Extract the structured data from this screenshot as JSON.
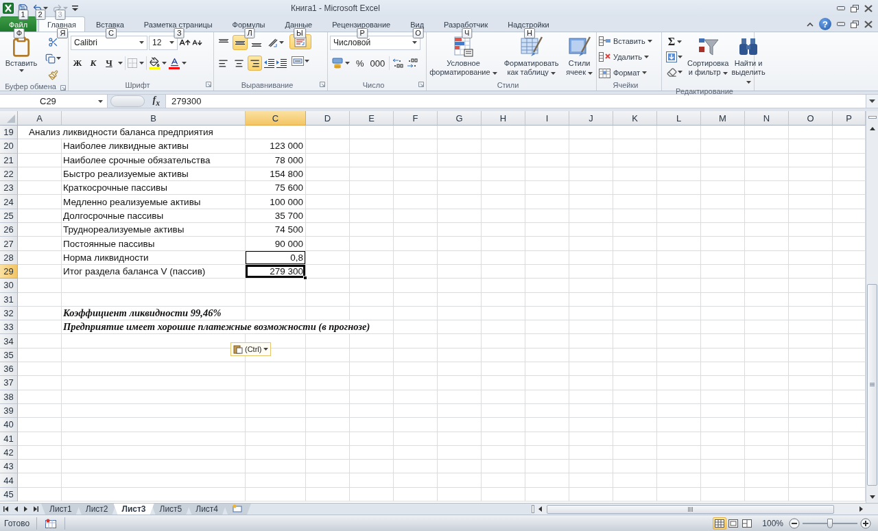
{
  "window": {
    "title": "Книга1  -  Microsoft Excel",
    "help": "?"
  },
  "quick_access": [
    {
      "kind": "save",
      "keytip": "1",
      "disabled": false
    },
    {
      "kind": "undo",
      "keytip": "2",
      "disabled": false
    },
    {
      "kind": "redo",
      "keytip": "3",
      "disabled": true
    }
  ],
  "tabs": [
    {
      "label": "Файл",
      "keytip": "Ф",
      "kind": "file",
      "selected": false
    },
    {
      "label": "Главная",
      "keytip": "Я",
      "kind": "tab",
      "selected": true
    },
    {
      "label": "Вставка",
      "keytip": "С",
      "kind": "tab",
      "selected": false
    },
    {
      "label": "Разметка страницы",
      "keytip": "З",
      "kind": "tab",
      "selected": false
    },
    {
      "label": "Формулы",
      "keytip": "Л",
      "kind": "tab",
      "selected": false
    },
    {
      "label": "Данные",
      "keytip": "Ы",
      "kind": "tab",
      "selected": false
    },
    {
      "label": "Рецензирование",
      "keytip": "Р",
      "kind": "tab",
      "selected": false
    },
    {
      "label": "Вид",
      "keytip": "О",
      "kind": "tab",
      "selected": false
    },
    {
      "label": "Разработчик",
      "keytip": "Ч",
      "kind": "tab",
      "selected": false
    },
    {
      "label": "Надстройки",
      "keytip": "Н",
      "kind": "tab",
      "selected": false
    }
  ],
  "ribbon": [
    {
      "kind": "clipboard",
      "label": "Буфер обмена",
      "launcher": true,
      "paste": "Вставить"
    },
    {
      "kind": "font",
      "label": "Шрифт",
      "launcher": true,
      "font_name": "Calibri",
      "font_size": "12",
      "bold": "Ж",
      "italic": "К",
      "underline": "Ч"
    },
    {
      "kind": "alignment",
      "label": "Выравнивание",
      "launcher": true,
      "vertical": [
        {
          "selected": false
        },
        {
          "selected": true
        },
        {
          "selected": false
        }
      ],
      "horizontal": [
        {
          "selected": false
        },
        {
          "selected": false
        },
        {
          "selected": true
        }
      ],
      "wrap_text": {
        "selected": true
      }
    },
    {
      "kind": "number",
      "label": "Число",
      "launcher": true,
      "format": "Числовой",
      "percent": "%",
      "thousands": "000"
    },
    {
      "kind": "styles",
      "label": "Стили",
      "launcher": false,
      "buttons": [
        "Условное форматирование",
        "Форматировать как таблицу",
        "Стили ячеек"
      ]
    },
    {
      "kind": "cells",
      "label": "Ячейки",
      "launcher": false,
      "buttons": [
        "Вставить",
        "Удалить",
        "Формат"
      ]
    },
    {
      "kind": "editing",
      "label": "Редактирование",
      "launcher": false,
      "sum": "Σ",
      "buttons": [
        "Сортировка и фильтр",
        "Найти и выделить"
      ]
    }
  ],
  "formula_bar": {
    "name_box": "C29",
    "function_icon": "f$_{x}$",
    "formula": "279300"
  },
  "columns": [
    {
      "label": "A",
      "selected": false
    },
    {
      "label": "B",
      "selected": false
    },
    {
      "label": "C",
      "selected": true
    },
    {
      "label": "D",
      "selected": false
    },
    {
      "label": "E",
      "selected": false
    },
    {
      "label": "F",
      "selected": false
    },
    {
      "label": "G",
      "selected": false
    },
    {
      "label": "H",
      "selected": false
    },
    {
      "label": "I",
      "selected": false
    },
    {
      "label": "J",
      "selected": false
    },
    {
      "label": "K",
      "selected": false
    },
    {
      "label": "L",
      "selected": false
    },
    {
      "label": "M",
      "selected": false
    },
    {
      "label": "N",
      "selected": false
    },
    {
      "label": "O",
      "selected": false
    },
    {
      "label": "P",
      "selected": false
    }
  ],
  "rows": [
    {
      "number": "19",
      "selected": false,
      "a": "Анализ ликвидности баланса предприятия"
    },
    {
      "number": "20",
      "selected": false,
      "b": {
        "text": "Наиболее ликвидные активы",
        "kind": "label"
      },
      "c": {
        "text": "123 000",
        "bordered": false,
        "selected": false
      }
    },
    {
      "number": "21",
      "selected": false,
      "b": {
        "text": "Наиболее срочные обязательства",
        "kind": "label"
      },
      "c": {
        "text": "78 000",
        "bordered": false,
        "selected": false
      }
    },
    {
      "number": "22",
      "selected": false,
      "b": {
        "text": "Быстро реализуемые активы",
        "kind": "label"
      },
      "c": {
        "text": "154 800",
        "bordered": false,
        "selected": false
      }
    },
    {
      "number": "23",
      "selected": false,
      "b": {
        "text": "Краткосрочные пассивы",
        "kind": "label"
      },
      "c": {
        "text": "75 600",
        "bordered": false,
        "selected": false
      }
    },
    {
      "number": "24",
      "selected": false,
      "b": {
        "text": "Медленно реализуемые активы",
        "kind": "label"
      },
      "c": {
        "text": "100 000",
        "bordered": false,
        "selected": false
      }
    },
    {
      "number": "25",
      "selected": false,
      "b": {
        "text": "Долгосрочные пассивы",
        "kind": "label"
      },
      "c": {
        "text": "35 700",
        "bordered": false,
        "selected": false
      }
    },
    {
      "number": "26",
      "selected": false,
      "b": {
        "text": "Труднореализуемые активы",
        "kind": "label"
      },
      "c": {
        "text": "74 500",
        "bordered": false,
        "selected": false
      }
    },
    {
      "number": "27",
      "selected": false,
      "b": {
        "text": "Постоянные пассивы",
        "kind": "label"
      },
      "c": {
        "text": "90 000",
        "bordered": false,
        "selected": false
      }
    },
    {
      "number": "28",
      "selected": false,
      "b": {
        "text": "Норма ликвидности",
        "kind": "label"
      },
      "c": {
        "text": "0,8",
        "bordered": true,
        "selected": false
      }
    },
    {
      "number": "29",
      "selected": true,
      "b": {
        "text": "Итог раздела баланса V (пассив)",
        "kind": "label"
      },
      "c": {
        "text": "279 300",
        "bordered": true,
        "selected": true
      }
    },
    {
      "number": "30",
      "selected": false
    },
    {
      "number": "31",
      "selected": false
    },
    {
      "number": "32",
      "selected": false,
      "b": {
        "text": "Коэффициент ликвидности 99,46%",
        "kind": "note"
      }
    },
    {
      "number": "33",
      "selected": false,
      "b": {
        "text": "Предприятие имеет хорошие платежные возможности (в прогнозе)",
        "kind": "note"
      }
    },
    {
      "number": "34",
      "selected": false
    },
    {
      "number": "35",
      "selected": false
    },
    {
      "number": "36",
      "selected": false
    },
    {
      "number": "37",
      "selected": false
    },
    {
      "number": "38",
      "selected": false
    },
    {
      "number": "39",
      "selected": false
    },
    {
      "number": "40",
      "selected": false
    },
    {
      "number": "41",
      "selected": false
    },
    {
      "number": "42",
      "selected": false
    },
    {
      "number": "43",
      "selected": false
    },
    {
      "number": "44",
      "selected": false
    },
    {
      "number": "45",
      "selected": false
    }
  ],
  "paste_options": {
    "label": "(Ctrl)"
  },
  "sheet_tabs": [
    {
      "label": "Лист1",
      "selected": false
    },
    {
      "label": "Лист2",
      "selected": false
    },
    {
      "label": "Лист3",
      "selected": true
    },
    {
      "label": "Лист5",
      "selected": false
    },
    {
      "label": "Лист4",
      "selected": false
    }
  ],
  "status_bar": {
    "status": "Готово",
    "views": [
      {
        "kind": "normal",
        "selected": true
      },
      {
        "kind": "page-layout",
        "selected": false
      },
      {
        "kind": "page-break",
        "selected": false
      }
    ],
    "zoom": "100%",
    "zoom_slider": {
      "level": 0.5
    }
  }
}
